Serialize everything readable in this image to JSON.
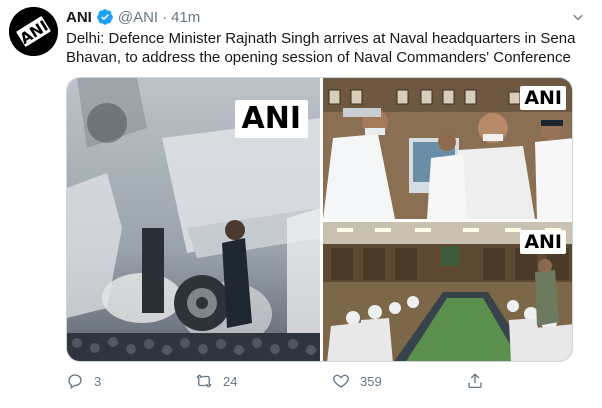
{
  "tweet": {
    "author_name": "ANI",
    "handle": "@ANI",
    "separator": "·",
    "time": "41m",
    "text": "Delhi: Defence Minister Rajnath Singh arrives at Naval headquarters in Sena Bhavan, to address the opening session of Naval Commanders' Conference",
    "avatar_logo_text": "ANI",
    "photos": [
      {
        "watermark": "ANI",
        "icon": "photo-naval-parade-aircraft"
      },
      {
        "watermark": "ANI",
        "icon": "photo-minister-arrival"
      },
      {
        "watermark": "ANI",
        "icon": "photo-conference-room"
      }
    ]
  },
  "actions": {
    "reply_count": "3",
    "retweet_count": "24",
    "like_count": "359",
    "share_count": ""
  },
  "colors": {
    "text": "#14171a",
    "secondary": "#657786",
    "verified": "#1da1f2",
    "border": "#ccd6dd"
  }
}
